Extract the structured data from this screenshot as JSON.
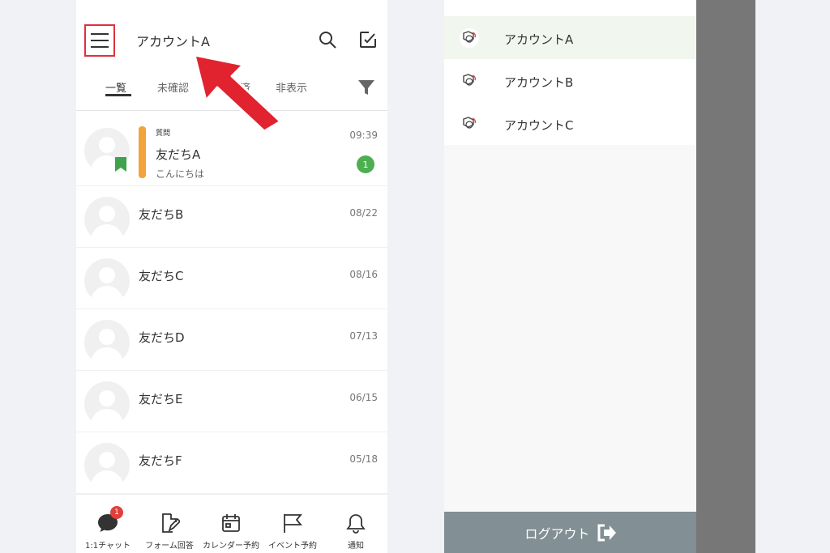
{
  "left_panel": {
    "header": {
      "title": "アカウントA"
    },
    "tabs": [
      {
        "label": "一覧"
      },
      {
        "label": "未確認"
      },
      {
        "label": "確認済"
      },
      {
        "label": "非表示"
      }
    ],
    "conversations": [
      {
        "tag": "質問",
        "name": "友だちA",
        "preview": "こんにちは",
        "time": "09:39",
        "unread": "1"
      },
      {
        "name": "友だちB",
        "time": "08/22"
      },
      {
        "name": "友だちC",
        "time": "08/16"
      },
      {
        "name": "友だちD",
        "time": "07/13"
      },
      {
        "name": "友だちE",
        "time": "06/15"
      },
      {
        "name": "友だちF",
        "time": "05/18"
      }
    ],
    "bottom_nav": [
      {
        "label": "1:1チャット",
        "badge": "1",
        "icon": "chat-bubble-icon"
      },
      {
        "label": "フォーム回答",
        "icon": "form-pen-icon"
      },
      {
        "label": "カレンダー予約",
        "icon": "calendar-icon"
      },
      {
        "label": "イベント予約",
        "icon": "flag-icon"
      },
      {
        "label": "通知",
        "icon": "bell-icon"
      }
    ]
  },
  "right_panel": {
    "accounts": [
      {
        "name": "アカウントA"
      },
      {
        "name": "アカウントB"
      },
      {
        "name": "アカウントC"
      }
    ],
    "logout_label": "ログアウト"
  },
  "colors": {
    "highlight_red": "#e0303c",
    "tag_orange": "#f2a33c",
    "badge_green": "#4caf50",
    "bookmark_green": "#3fa34d",
    "logout_gray": "#828f94"
  }
}
